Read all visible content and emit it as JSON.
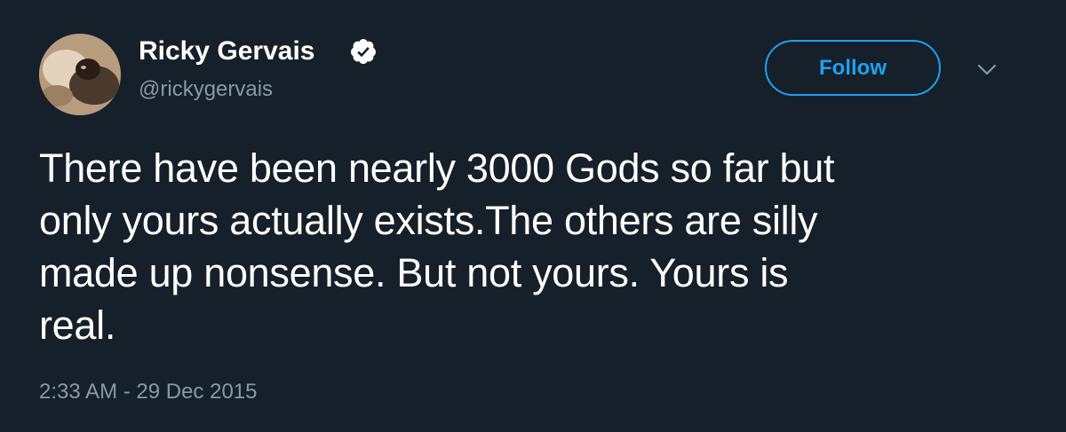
{
  "user": {
    "display_name": "Ricky Gervais",
    "handle": "@rickygervais",
    "verified": true
  },
  "actions": {
    "follow_label": "Follow"
  },
  "tweet": {
    "lines": [
      "There have been nearly 3000 Gods so far but",
      "only yours actually exists.The others are silly",
      "made up nonsense. But not yours. Yours is",
      "real."
    ],
    "timestamp": "2:33 AM - 29 Dec 2015"
  },
  "icons": {
    "verified": "verified-badge-icon",
    "caret": "chevron-down-icon"
  },
  "colors": {
    "background": "#15202b",
    "accent": "#1da1f2",
    "secondary_text": "#8899a6",
    "primary_text": "#ffffff"
  }
}
